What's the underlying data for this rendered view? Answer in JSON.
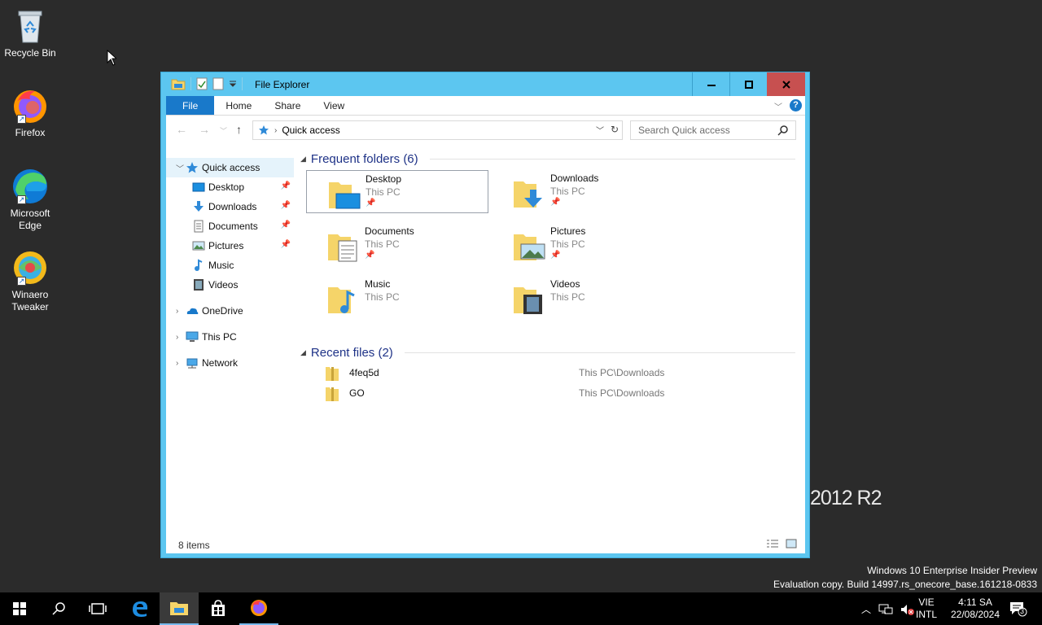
{
  "desktop": {
    "icons": [
      {
        "label": "Recycle Bin",
        "icon": "recycle-bin-icon"
      },
      {
        "label": "Firefox",
        "icon": "firefox-icon"
      },
      {
        "label": "Microsoft Edge",
        "icon": "edge-icon"
      },
      {
        "label": "Winaero Tweaker",
        "icon": "winaero-icon"
      }
    ],
    "watermark": "2012 R2",
    "build_line1": "Windows 10 Enterprise Insider Preview",
    "build_line2": "Evaluation copy. Build 14997.rs_onecore_base.161218-0833"
  },
  "window": {
    "title": "File Explorer",
    "ribbon_tabs": [
      "File",
      "Home",
      "Share",
      "View"
    ],
    "help": "?",
    "address": "Quick access",
    "search_placeholder": "Search Quick access",
    "status": "8 items"
  },
  "nav": {
    "quick_access": "Quick access",
    "children": [
      {
        "label": "Desktop",
        "pinned": true
      },
      {
        "label": "Downloads",
        "pinned": true
      },
      {
        "label": "Documents",
        "pinned": true
      },
      {
        "label": "Pictures",
        "pinned": true
      },
      {
        "label": "Music",
        "pinned": false
      },
      {
        "label": "Videos",
        "pinned": false
      }
    ],
    "onedrive": "OneDrive",
    "this_pc": "This PC",
    "network": "Network"
  },
  "frequent": {
    "heading": "Frequent folders (6)",
    "folders": [
      {
        "name": "Desktop",
        "location": "This PC",
        "pinned": true
      },
      {
        "name": "Downloads",
        "location": "This PC",
        "pinned": true
      },
      {
        "name": "Documents",
        "location": "This PC",
        "pinned": true
      },
      {
        "name": "Pictures",
        "location": "This PC",
        "pinned": true
      },
      {
        "name": "Music",
        "location": "This PC",
        "pinned": false
      },
      {
        "name": "Videos",
        "location": "This PC",
        "pinned": false
      }
    ]
  },
  "recent": {
    "heading": "Recent files (2)",
    "files": [
      {
        "name": "4feq5d",
        "path": "This PC\\Downloads"
      },
      {
        "name": "GO",
        "path": "This PC\\Downloads"
      }
    ]
  },
  "taskbar": {
    "lang_line1": "VIE",
    "lang_line2": "INTL",
    "time": "4:11 SA",
    "date": "22/08/2024",
    "notification_count": "3"
  },
  "colors": {
    "accent": "#1979ca",
    "window_frame": "#5cc6f0",
    "close_button": "#c75050",
    "folder_yellow": "#f5d469"
  }
}
